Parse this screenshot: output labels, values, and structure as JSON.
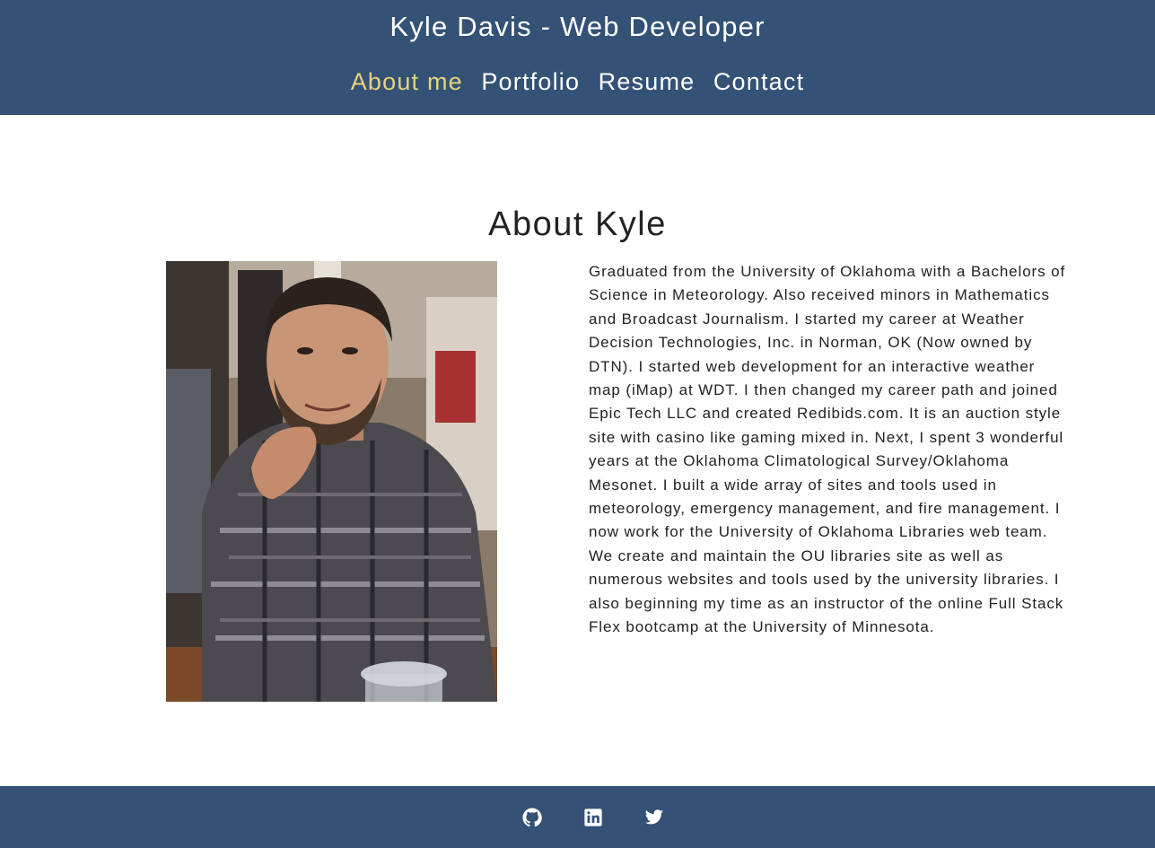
{
  "header": {
    "title": "Kyle Davis - Web Developer",
    "nav": [
      {
        "label": "About me",
        "active": true
      },
      {
        "label": "Portfolio",
        "active": false
      },
      {
        "label": "Resume",
        "active": false
      },
      {
        "label": "Contact",
        "active": false
      }
    ]
  },
  "main": {
    "heading": "About Kyle",
    "bio": "Graduated from the University of Oklahoma with a Bachelors of Science in Meteorology. Also received minors in Mathematics and Broadcast Journalism. I started my career at Weather Decision Technologies, Inc. in Norman, OK (Now owned by DTN). I started web development for an interactive weather map (iMap) at WDT. I then changed my career path and joined Epic Tech LLC and created Redibids.com. It is an auction style site with casino like gaming mixed in. Next, I spent 3 wonderful years at the Oklahoma Climatological Survey/Oklahoma Mesonet. I built a wide array of sites and tools used in meteorology, emergency management, and fire management. I now work for the University of Oklahoma Libraries web team. We create and maintain the OU libraries site as well as numerous websites and tools used by the university libraries. I also beginning my time as an instructor of the online Full Stack Flex bootcamp at the University of Minnesota."
  },
  "footer": {
    "social": [
      {
        "icon": "github-icon"
      },
      {
        "icon": "linkedin-icon"
      },
      {
        "icon": "twitter-icon"
      }
    ]
  },
  "colors": {
    "header_bg": "#345176",
    "active_nav": "#e8d27c",
    "text": "#222222"
  }
}
